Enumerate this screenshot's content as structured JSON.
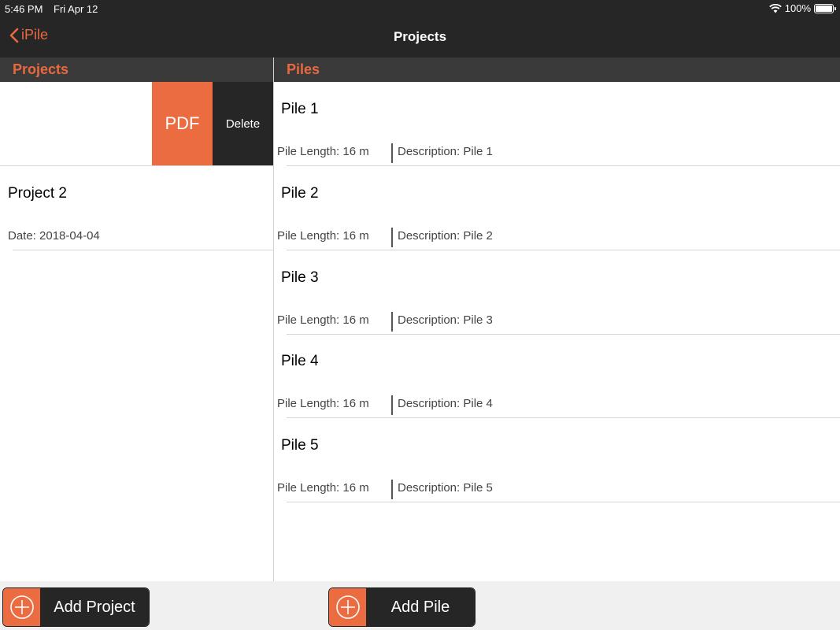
{
  "status_bar": {
    "time": "5:46 PM",
    "date": "Fri Apr 12",
    "battery": "100%"
  },
  "nav": {
    "back_label": "iPile",
    "title": "Projects"
  },
  "projects_panel": {
    "header": "Projects",
    "swipe_actions": {
      "pdf": "PDF",
      "delete": "Delete"
    },
    "items": [
      {
        "name": "Project 2",
        "date": "Date: 2018-04-04"
      }
    ]
  },
  "piles_panel": {
    "header": "Piles",
    "items": [
      {
        "name": "Pile 1",
        "length": "Pile Length: 16 m",
        "description": "Description: Pile 1"
      },
      {
        "name": "Pile 2",
        "length": "Pile Length: 16 m",
        "description": "Description: Pile 2"
      },
      {
        "name": "Pile 3",
        "length": "Pile Length: 16 m",
        "description": "Description: Pile 3"
      },
      {
        "name": "Pile 4",
        "length": "Pile Length: 16 m",
        "description": "Description: Pile 4"
      },
      {
        "name": "Pile 5",
        "length": "Pile Length: 16 m",
        "description": "Description: Pile 5"
      }
    ]
  },
  "toolbar": {
    "add_project": "Add Project",
    "add_pile": "Add Pile"
  },
  "colors": {
    "accent": "#ec6c42",
    "dark": "#262626",
    "header_bg": "#3a3a3a"
  },
  "icons": [
    "wifi-icon",
    "battery-icon",
    "chevron-left-icon",
    "plus-circle-icon"
  ]
}
